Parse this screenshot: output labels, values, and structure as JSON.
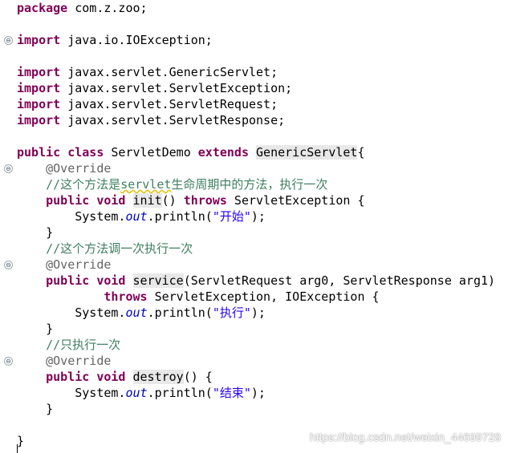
{
  "editor": {
    "lines": {
      "l1": {
        "kw": "package",
        "rest": " com.z.zoo;"
      },
      "l2": {
        "kw": "import",
        "rest": " java.io.IOException;"
      },
      "l3": {
        "kw": "import",
        "rest": " javax.servlet.GenericServlet;"
      },
      "l4": {
        "kw": "import",
        "rest": " javax.servlet.ServletException;"
      },
      "l5": {
        "kw": "import",
        "rest": " javax.servlet.ServletRequest;"
      },
      "l6": {
        "kw": "import",
        "rest": " javax.servlet.ServletResponse;"
      },
      "l7": {
        "kw1": "public",
        "kw2": "class",
        "name": " ServletDemo ",
        "kw3": "extends",
        "parent": "GenericServlet",
        "rest": "{"
      },
      "l8": {
        "annotation": "@Override"
      },
      "l9": {
        "comment_a": "//这个方法是",
        "comment_b": "servlet",
        "comment_c": "生命周期中的方法，执行一次"
      },
      "l10": {
        "kw1": "public",
        "kw2": "void",
        "method": "init",
        "mid": "() ",
        "kw3": "throws",
        "rest": " ServletException {"
      },
      "l11": {
        "pre": "System.",
        "field": "out",
        "mid": ".println(",
        "str": "\"开始\"",
        "post": ");"
      },
      "l12": {
        "text": "}"
      },
      "l13": {
        "comment": "//这个方法调一次执行一次"
      },
      "l14": {
        "annotation": "@Override"
      },
      "l15": {
        "kw1": "public",
        "kw2": "void",
        "method": "service",
        "rest": "(ServletRequest arg0, ServletResponse arg1)"
      },
      "l16": {
        "kw": "throws",
        "rest": " ServletException, IOException {"
      },
      "l17": {
        "pre": "System.",
        "field": "out",
        "mid": ".println(",
        "str": "\"执行\"",
        "post": ");"
      },
      "l18": {
        "text": "}"
      },
      "l19": {
        "comment": "//只执行一次"
      },
      "l20": {
        "annotation": "@Override"
      },
      "l21": {
        "kw1": "public",
        "kw2": "void",
        "method": "destroy",
        "rest": "() {"
      },
      "l22": {
        "pre": "System.",
        "field": "out",
        "mid": ".println(",
        "str": "\"结束\"",
        "post": ");"
      },
      "l23": {
        "text": "}"
      },
      "l24": {
        "text": "}"
      }
    },
    "fold_glyph": "⊖"
  },
  "watermark": "https://blog.csdn.net/weixin_44699728",
  "colors": {
    "keyword": "#7f0055",
    "comment": "#3f7f5f",
    "annotation": "#646464",
    "string": "#2a00ff",
    "field": "#0000c0"
  }
}
